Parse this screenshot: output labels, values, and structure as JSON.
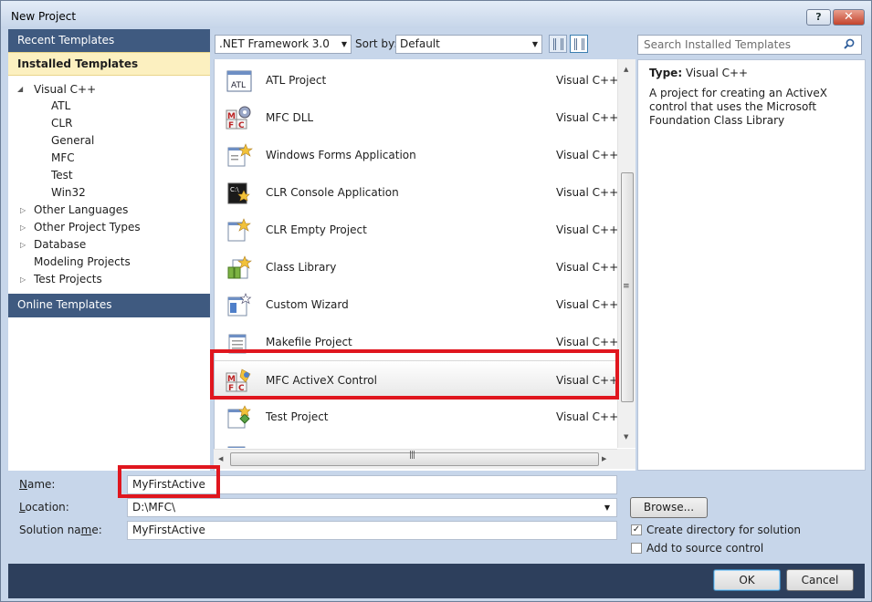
{
  "window": {
    "title": "New Project",
    "help_label": "?",
    "close_label": "✕"
  },
  "left_nav": {
    "recent_templates": "Recent Templates",
    "installed_templates": "Installed Templates",
    "tree": [
      {
        "label": "Visual C++",
        "expanded": true
      },
      {
        "label": "ATL"
      },
      {
        "label": "CLR"
      },
      {
        "label": "General"
      },
      {
        "label": "MFC"
      },
      {
        "label": "Test"
      },
      {
        "label": "Win32"
      },
      {
        "label": "Other Languages",
        "expanded": false
      },
      {
        "label": "Other Project Types",
        "expanded": false
      },
      {
        "label": "Database",
        "expanded": false
      },
      {
        "label": "Modeling Projects"
      },
      {
        "label": "Test Projects",
        "expanded": false
      }
    ],
    "online_templates": "Online Templates"
  },
  "toolbar": {
    "framework": ".NET Framework 3.0",
    "sort_label": "Sort by:",
    "sort_value": "Default"
  },
  "search": {
    "placeholder": "Search Installed Templates"
  },
  "templates": [
    {
      "name": "ATL Project",
      "language": "Visual C++",
      "icon": "atl-icon"
    },
    {
      "name": "MFC DLL",
      "language": "Visual C++",
      "icon": "mfc-gear-icon"
    },
    {
      "name": "Windows Forms Application",
      "language": "Visual C++",
      "icon": "winforms-icon"
    },
    {
      "name": "CLR Console Application",
      "language": "Visual C++",
      "icon": "console-icon"
    },
    {
      "name": "CLR Empty Project",
      "language": "Visual C++",
      "icon": "empty-project-icon"
    },
    {
      "name": "Class Library",
      "language": "Visual C++",
      "icon": "class-library-icon"
    },
    {
      "name": "Custom Wizard",
      "language": "Visual C++",
      "icon": "wizard-icon"
    },
    {
      "name": "Makefile Project",
      "language": "Visual C++",
      "icon": "makefile-icon"
    },
    {
      "name": "MFC ActiveX Control",
      "language": "Visual C++",
      "icon": "mfc-activex-icon",
      "selected": true
    },
    {
      "name": "Test Project",
      "language": "Visual C++",
      "icon": "test-icon"
    }
  ],
  "description": {
    "type_label": "Type:",
    "type_value": "Visual C++",
    "text": "A project for creating an ActiveX control that uses the Microsoft Foundation Class Library"
  },
  "form": {
    "name_label": "Name:",
    "name_value": "MyFirstActive",
    "location_label": "Location:",
    "location_value": "D:\\MFC\\",
    "solution_label": "Solution name:",
    "solution_value": "MyFirstActive",
    "browse_label": "Browse...",
    "create_dir_label": "Create directory for solution",
    "create_dir_checked": true,
    "source_control_label": "Add to source control",
    "source_control_checked": false
  },
  "buttons": {
    "ok": "OK",
    "cancel": "Cancel"
  },
  "colors": {
    "highlight_box": "#e0161e",
    "nav_header": "#3f5a80",
    "footer": "#2d3f5c"
  }
}
